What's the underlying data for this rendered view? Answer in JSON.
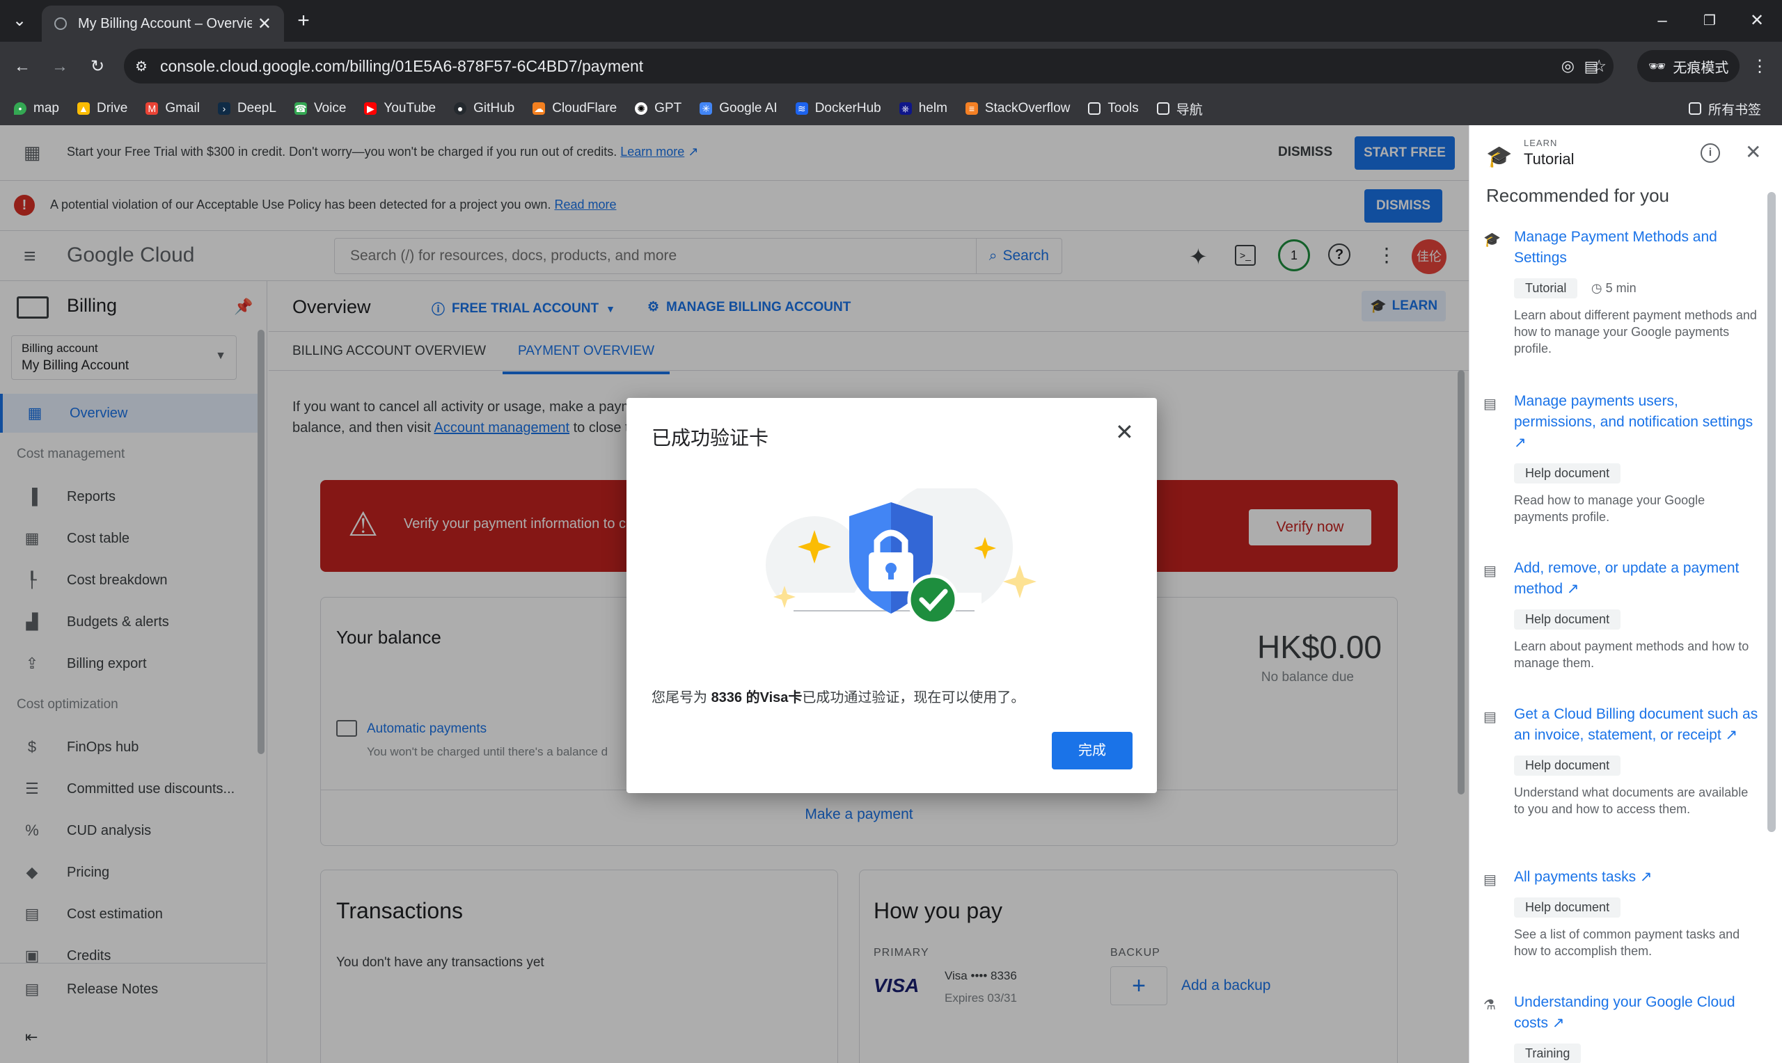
{
  "browser": {
    "tab_title": "My Billing Account – Overvie",
    "url": "console.cloud.google.com/billing/01E5A6-878F57-6C4BD7/payment",
    "incognito_label": "无痕模式",
    "bookmarks": [
      "map",
      "Drive",
      "Gmail",
      "DeepL",
      "Voice",
      "YouTube",
      "GitHub",
      "CloudFlare",
      "GPT",
      "Google AI",
      "DockerHub",
      "helm",
      "StackOverflow",
      "Tools",
      "导航"
    ],
    "all_bookmarks": "所有书签"
  },
  "trial_banner": {
    "text": "Start your Free Trial with $300 in credit. Don't worry—you won't be charged if you run out of credits.",
    "link": "Learn more",
    "dismiss": "DISMISS",
    "start": "START FREE"
  },
  "policy_banner": {
    "text": "A potential violation of our Acceptable Use Policy has been detected for a project you own.",
    "link": "Read more",
    "dismiss": "DISMISS"
  },
  "header": {
    "logo": "Google Cloud",
    "search_placeholder": "Search (/) for resources, docs, products, and more",
    "search_button": "Search",
    "notif_count": "1",
    "avatar": "佳伦"
  },
  "sidebar": {
    "title": "Billing",
    "account_label": "Billing account",
    "account_value": "My Billing Account",
    "overview": "Overview",
    "section_cost_mgmt": "Cost management",
    "cost_items": [
      "Reports",
      "Cost table",
      "Cost breakdown",
      "Budgets & alerts",
      "Billing export"
    ],
    "section_cost_opt": "Cost optimization",
    "opt_items": [
      "FinOps hub",
      "Committed use discounts...",
      "CUD analysis",
      "Pricing",
      "Cost estimation",
      "Credits"
    ],
    "release_notes": "Release Notes"
  },
  "main": {
    "title": "Overview",
    "free_trial": "FREE TRIAL ACCOUNT",
    "manage": "MANAGE BILLING ACCOUNT",
    "learn": "LEARN",
    "tabs": [
      "BILLING ACCOUNT OVERVIEW",
      "PAYMENT OVERVIEW"
    ],
    "cancel_text_1": "If you want to cancel all activity or usage, make a payme",
    "cancel_text_2a": "balance, and then visit",
    "cancel_link": "Account management",
    "cancel_text_2b": "to close th",
    "verify_text": "Verify your payment information to c",
    "verify_button": "Verify now",
    "balance_title": "Your balance",
    "balance_amount": "HK$0.00",
    "balance_due": "No balance due",
    "auto_payments": "Automatic payments",
    "auto_note": "You won't be charged until there's a balance d",
    "make_payment": "Make a payment",
    "transactions_title": "Transactions",
    "transactions_empty": "You don't have any transactions yet",
    "how_you_pay": "How you pay",
    "primary": "PRIMARY",
    "backup": "BACKUP",
    "card_brand": "VISA",
    "card_number": "Visa •••• 8336",
    "card_expiry": "Expires 03/31",
    "add_backup": "Add a backup"
  },
  "dialog": {
    "title": "已成功验证卡",
    "msg_a": "您尾号为 ",
    "msg_bold": "8336 的Visa卡",
    "msg_b": "已成功通过验证，现在可以使用了。",
    "done": "完成"
  },
  "learn_panel": {
    "eyebrow": "LEARN",
    "title": "Tutorial",
    "recommended": "Recommended for you",
    "items": [
      {
        "title": "Manage Payment Methods and Settings",
        "tag": "Tutorial",
        "time": "5 min",
        "desc": "Learn about different payment methods and how to manage your Google payments profile."
      },
      {
        "title": "Manage payments users, permissions, and notification settings",
        "tag": "Help document",
        "desc": "Read how to manage your Google payments profile."
      },
      {
        "title": "Add, remove, or update a payment method",
        "tag": "Help document",
        "desc": "Learn about payment methods and how to manage them."
      },
      {
        "title": "Get a Cloud Billing document such as an invoice, statement, or receipt",
        "tag": "Help document",
        "desc": "Understand what documents are available to you and how to access them."
      },
      {
        "title": "All payments tasks",
        "tag": "Help document",
        "desc": "See a list of common payment tasks and how to accomplish them."
      },
      {
        "title": "Understanding your Google Cloud costs",
        "tag": "Training",
        "desc": ""
      }
    ]
  },
  "colors": {
    "accent": "#1a73e8",
    "danger": "#c5221f",
    "success": "#1e8e3e",
    "star": "#fbbc04"
  }
}
